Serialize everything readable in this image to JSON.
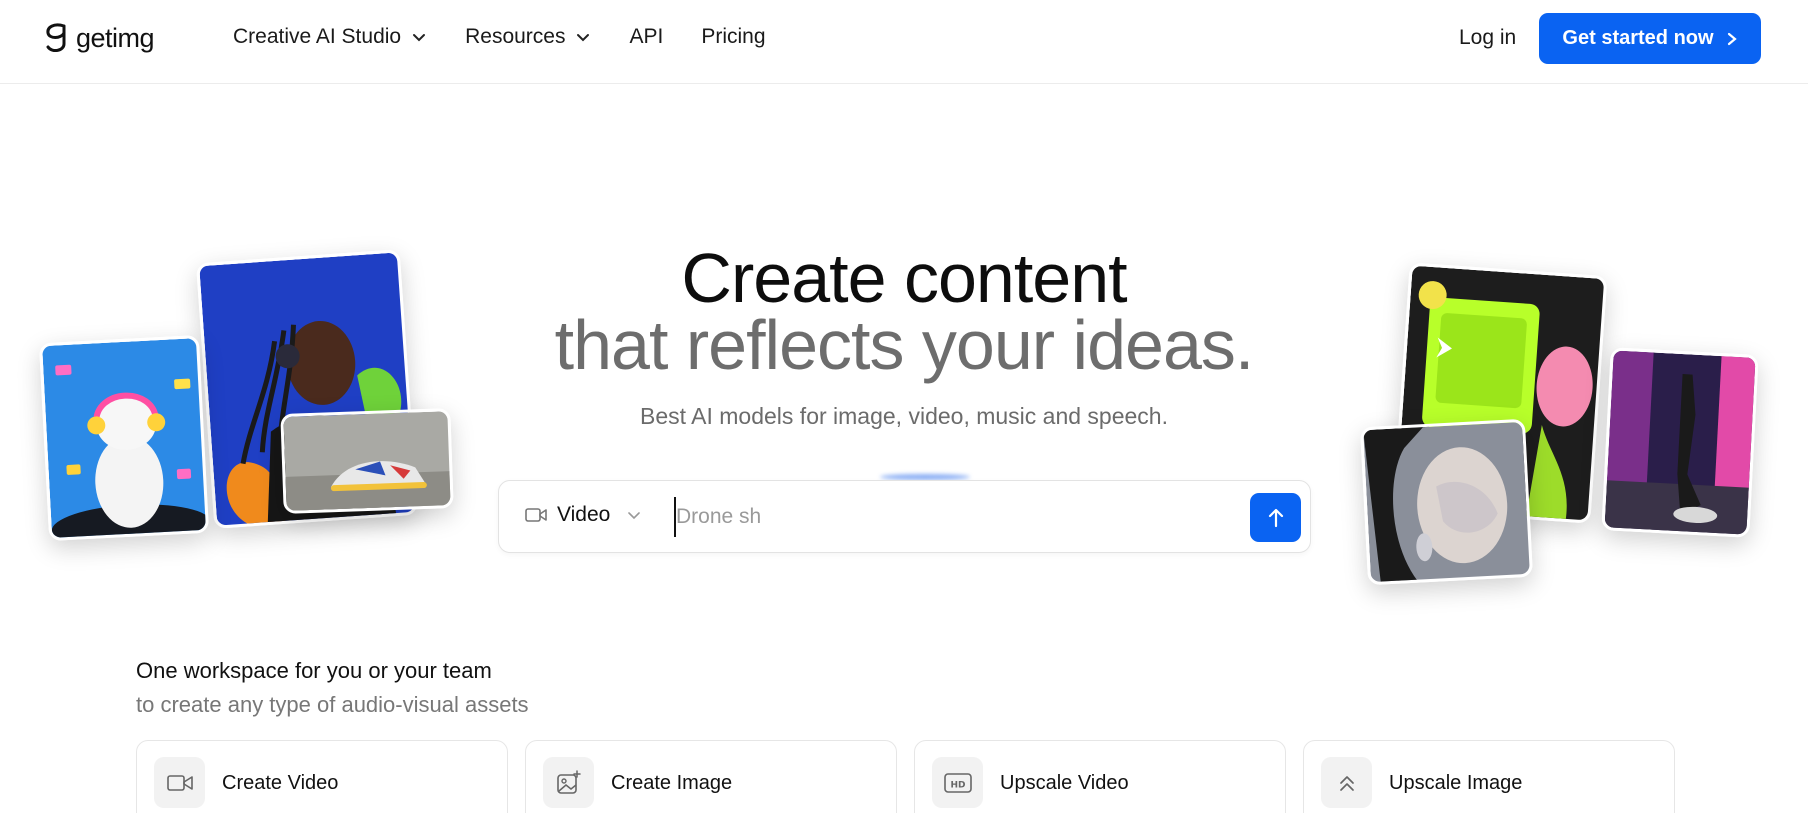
{
  "brand": {
    "name": "getimg",
    "accent": "#0a63f2"
  },
  "nav": {
    "links": [
      {
        "label": "Creative AI Studio",
        "dropdown": true
      },
      {
        "label": "Resources",
        "dropdown": true
      },
      {
        "label": "API",
        "dropdown": false
      },
      {
        "label": "Pricing",
        "dropdown": false
      }
    ],
    "login": "Log in",
    "cta": "Get started now"
  },
  "hero": {
    "title_line1": "Create content",
    "title_line2": "that reflects your ideas.",
    "subtitle": "Best AI models for image, video, music and speech."
  },
  "prompt": {
    "mode": "Video",
    "mode_icon": "video-camera-icon",
    "value": "Drone sh",
    "send_icon": "arrow-up-icon"
  },
  "workspace": {
    "title": "One workspace for you or your team",
    "subtitle": "to create any type of audio-visual assets",
    "tiles": [
      {
        "label": "Create Video",
        "icon": "video-camera-icon"
      },
      {
        "label": "Create Image",
        "icon": "image-sparkle-icon"
      },
      {
        "label": "Upscale Video",
        "icon": "hd-icon"
      },
      {
        "label": "Upscale Image",
        "icon": "double-chevron-up-icon"
      }
    ]
  }
}
